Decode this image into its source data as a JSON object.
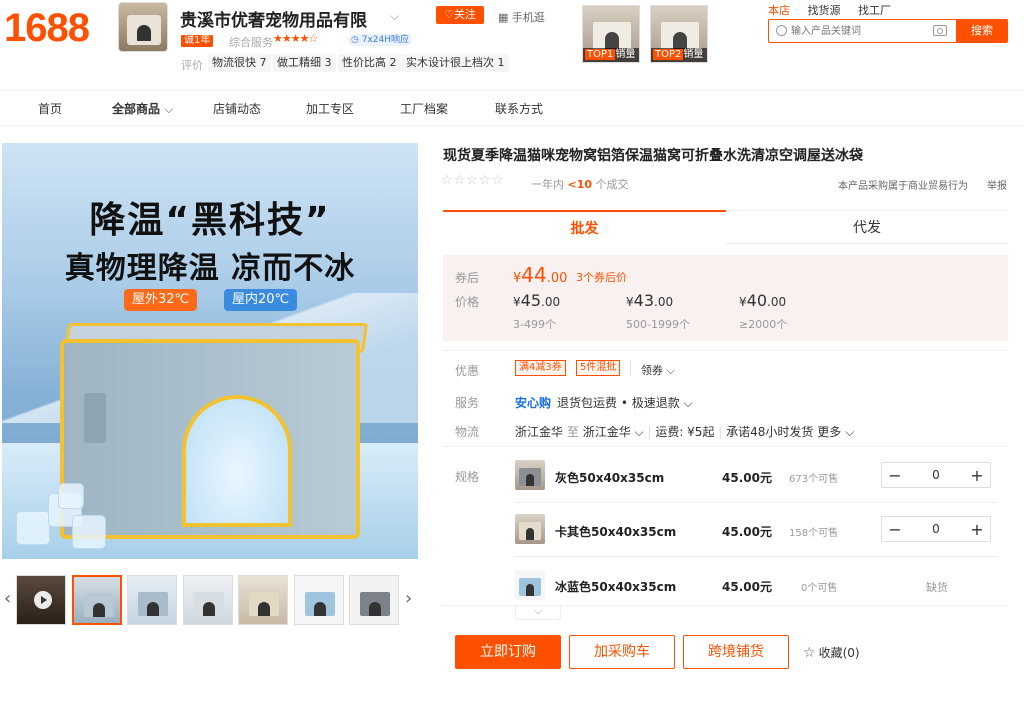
{
  "header": {
    "logo": "1688",
    "shop_name": "贵溪市优奢宠物用品有限",
    "follow": "关注",
    "mobile": "手机逛",
    "year_badge": "诚1年",
    "service_label": "综合服务",
    "rating_stars": "★★★★☆",
    "response": "7x24H响应",
    "eval_label": "评价",
    "eval_tags": [
      "物流很快 7",
      "做工精细 3",
      "性价比高 2",
      "实木设计很上档次 1"
    ],
    "top_sellers": [
      {
        "rank": "TOP1",
        "label": "销量"
      },
      {
        "rank": "TOP2",
        "label": "销量"
      }
    ],
    "search": {
      "tabs": [
        "本店",
        "找货源",
        "找工厂"
      ],
      "placeholder": "输入产品关键词",
      "button": "搜索"
    }
  },
  "nav": [
    "首页",
    "全部商品",
    "店铺动态",
    "加工专区",
    "工厂档案",
    "联系方式"
  ],
  "main_image": {
    "headline": "降温“黑科技”",
    "subline": "真物理降温 凉而不冰",
    "outdoor": "屋外32℃",
    "indoor": "屋内20℃"
  },
  "product": {
    "title": "现货夏季降温猫咪宠物窝铝箔保温猫窝可折叠水洗清凉空调屋送冰袋",
    "stars": "☆☆☆☆☆",
    "sales_prefix": "一年内",
    "sales_count": "<10",
    "sales_suffix": "个成交",
    "trade_note": "本产品采购属于商业贸易行为",
    "report": "举报",
    "tabs": [
      "批发",
      "代发"
    ],
    "price": {
      "coupon_label": "券后",
      "coupon_currency": "¥",
      "coupon_int": "44",
      "coupon_dec": ".00",
      "coupon_note": "3个券后价",
      "price_label": "价格",
      "tiers": [
        {
          "currency": "¥",
          "int": "45",
          "dec": ".00",
          "qty": "3-499个"
        },
        {
          "currency": "¥",
          "int": "43",
          "dec": ".00",
          "qty": "500-1999个"
        },
        {
          "currency": "¥",
          "int": "40",
          "dec": ".00",
          "qty": "≥2000个"
        }
      ]
    },
    "promo": {
      "label": "优惠",
      "tags": [
        "满4减3券",
        "5件混批"
      ],
      "get_coupon": "领券 ⌵"
    },
    "service": {
      "label": "服务",
      "main": "安心购",
      "detail": "退货包运费 • 极速退款 ⌵"
    },
    "logistics": {
      "label": "物流",
      "from": "浙江金华",
      "to_word": "至",
      "to": "浙江金华 ⌵",
      "fee": "运费: ¥5起",
      "promise": "承诺48小时发货",
      "more": "更多 ⌵"
    },
    "sku_label": "规格",
    "skus": [
      {
        "name": "灰色50x40x35cm",
        "price": "45.00元",
        "stock": "673个可售",
        "qty": "0",
        "color": "#8a8f94"
      },
      {
        "name": "卡其色50x40x35cm",
        "price": "45.00元",
        "stock": "158个可售",
        "qty": "0",
        "color": "#e6dccb"
      },
      {
        "name": "冰蓝色50x40x35cm",
        "price": "45.00元",
        "stock": "0个可售",
        "soldout": "缺货",
        "color": "#9fc4de"
      }
    ],
    "expand": "⌵",
    "actions": {
      "order": "立即订购",
      "cart": "加采购车",
      "cross_border": "跨境铺货",
      "favorite": "收藏(0)"
    }
  },
  "thumbnails": [
    {
      "name": "video"
    },
    {
      "name": "thumb-1"
    },
    {
      "name": "thumb-2"
    },
    {
      "name": "thumb-3"
    },
    {
      "name": "thumb-4"
    },
    {
      "name": "thumb-5"
    },
    {
      "name": "thumb-6"
    }
  ],
  "colors": {
    "accent": "#ff5000",
    "link": "#1a6ee8"
  }
}
